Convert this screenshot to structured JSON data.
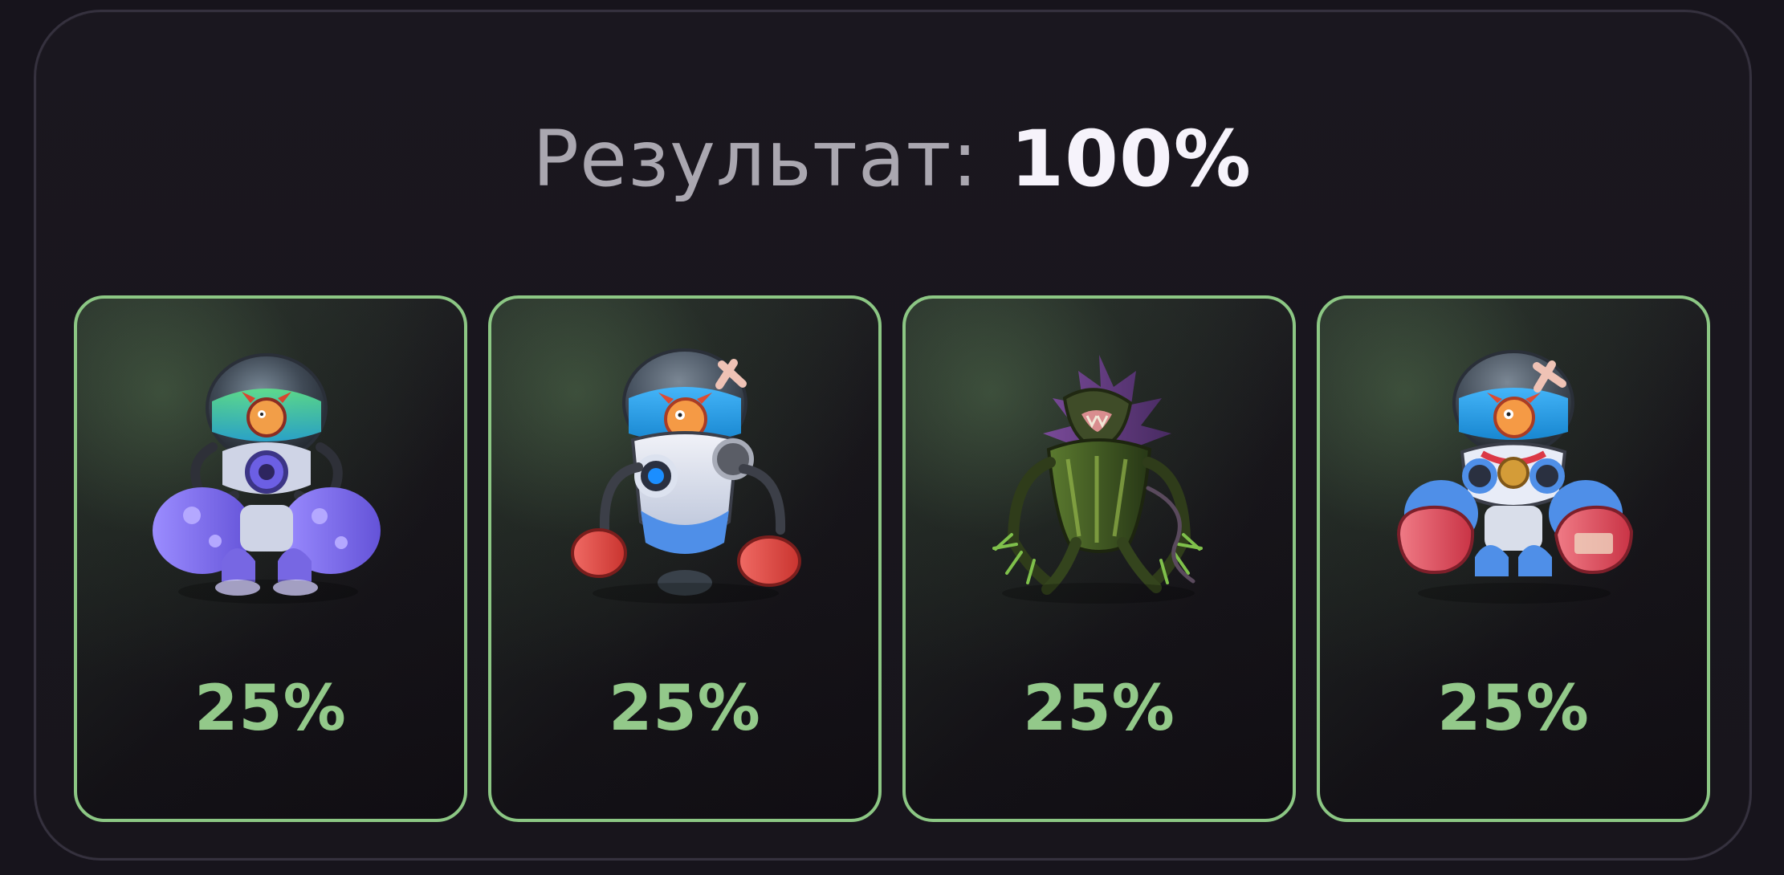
{
  "result": {
    "label": "Результат:",
    "value": "100%"
  },
  "cards": [
    {
      "name": "purple-fish-robot",
      "percent": "25%",
      "icon": "purple-fish-mech-icon"
    },
    {
      "name": "boxing-capsule-robot",
      "percent": "25%",
      "icon": "boxing-capsule-robot-icon"
    },
    {
      "name": "green-creature",
      "percent": "25%",
      "icon": "green-creature-icon"
    },
    {
      "name": "red-blue-fish-robot",
      "percent": "25%",
      "icon": "red-blue-fish-mech-icon"
    }
  ],
  "colors": {
    "background": "#17141c",
    "panel_border": "#35313e",
    "accent_green": "#8cc784",
    "percent_green": "#93c98a",
    "result_label": "#aaa7b0",
    "result_value": "#f6f3fb"
  }
}
